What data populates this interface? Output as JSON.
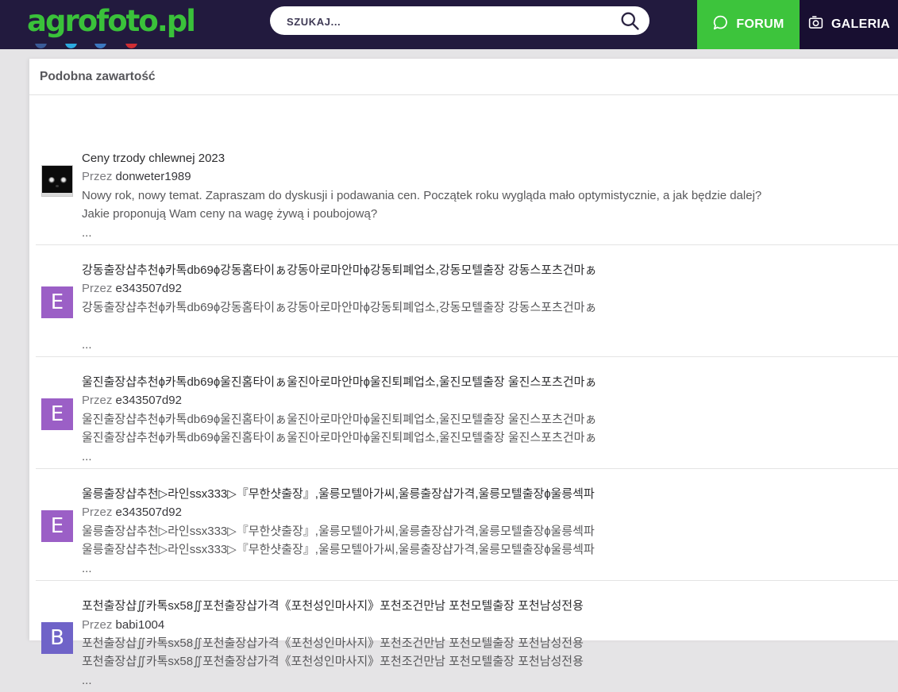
{
  "header": {
    "logo_text": "agrofoto.pl",
    "search_placeholder": "SZUKAJ...",
    "forum_label": "FORUM",
    "galeria_label": "GALERIA",
    "colors": {
      "bar_bg": "#221a3e",
      "logo_green": "#3ac13a",
      "forum_green": "#3dc43c",
      "galeria_bg": "#180f31"
    }
  },
  "social_icons": [
    {
      "name": "facebook-icon",
      "color": "#3a5a97"
    },
    {
      "name": "twitter-icon",
      "color": "#2caae1"
    },
    {
      "name": "linkedin-icon",
      "color": "#3b77c0"
    },
    {
      "name": "youtube-icon",
      "color": "#cf2d33"
    }
  ],
  "similar": {
    "title": "Podobna zawartość",
    "by_label": "Przez",
    "threads": [
      {
        "title": "Ceny trzody chlewnej 2023",
        "author": "donweter1989",
        "avatar": {
          "kind": "image",
          "description": "black-cat-photo"
        },
        "body": [
          "Nowy rok, nowy temat. Zapraszam do dyskusji i podawania cen. Początek roku wygląda mało optymistycznie, a jak będzie dalej?",
          "Jakie proponują Wam ceny na wagę żywą i poubojową?"
        ],
        "ellipsis": "..."
      },
      {
        "title": "강동출장샵추천ɸ카톡db69ɸ강동홈타이ぁ강동아로마안마ɸ강동퇴폐업소,강동모텔출장 강동스포츠건마ぁ",
        "author": "e343507d92",
        "avatar": {
          "kind": "letter",
          "letter": "E",
          "bg": "#9b5fc6"
        },
        "body": [
          "강동출장샵추천ɸ카톡db69ɸ강동홈타이ぁ강동아로마안마ɸ강동퇴폐업소,강동모텔출장 강동스포츠건마ぁ",
          ""
        ],
        "ellipsis": "..."
      },
      {
        "title": "울진출장샵추천ɸ카톡db69ɸ울진홈타이ぁ울진아로마안마ɸ울진퇴폐업소,울진모텔출장 울진스포츠건마ぁ",
        "author": "e343507d92",
        "avatar": {
          "kind": "letter",
          "letter": "E",
          "bg": "#9b5fc6"
        },
        "body": [
          "울진출장샵추천ɸ카톡db69ɸ울진홈타이ぁ울진아로마안마ɸ울진퇴폐업소,울진모텔출장 울진스포츠건마ぁ",
          "울진출장샵추천ɸ카톡db69ɸ울진홈타이ぁ울진아로마안마ɸ울진퇴폐업소,울진모텔출장 울진스포츠건마ぁ"
        ],
        "ellipsis": "..."
      },
      {
        "title": "울릉출장샵추천▷라인ssx333▷『무한샷출장』,울릉모텔아가씨,울릉출장샵가격,울릉모텔출장ɸ울릉섹파",
        "author": "e343507d92",
        "avatar": {
          "kind": "letter",
          "letter": "E",
          "bg": "#9b5fc6"
        },
        "body": [
          "울릉출장샵추천▷라인ssx333▷『무한샷출장』,울릉모텔아가씨,울릉출장샵가격,울릉모텔출장ɸ울릉섹파",
          "울릉출장샵추천▷라인ssx333▷『무한샷출장』,울릉모텔아가씨,울릉출장샵가격,울릉모텔출장ɸ울릉섹파"
        ],
        "ellipsis": "..."
      },
      {
        "title": "포천출장샵∬카톡sx58∬포천출장샵가격《포천성인마사지》포천조건만남 포천모텔출장 포천남성전용",
        "author": "babi1004",
        "avatar": {
          "kind": "letter",
          "letter": "B",
          "bg": "#6f63c8"
        },
        "body": [
          "포천출장샵∬카톡sx58∬포천출장샵가격《포천성인마사지》포천조건만남 포천모텔출장 포천남성전용",
          "포천출장샵∬카톡sx58∬포천출장샵가격《포천성인마사지》포천조건만남 포천모텔출장 포천남성전용"
        ],
        "ellipsis": "..."
      }
    ]
  }
}
